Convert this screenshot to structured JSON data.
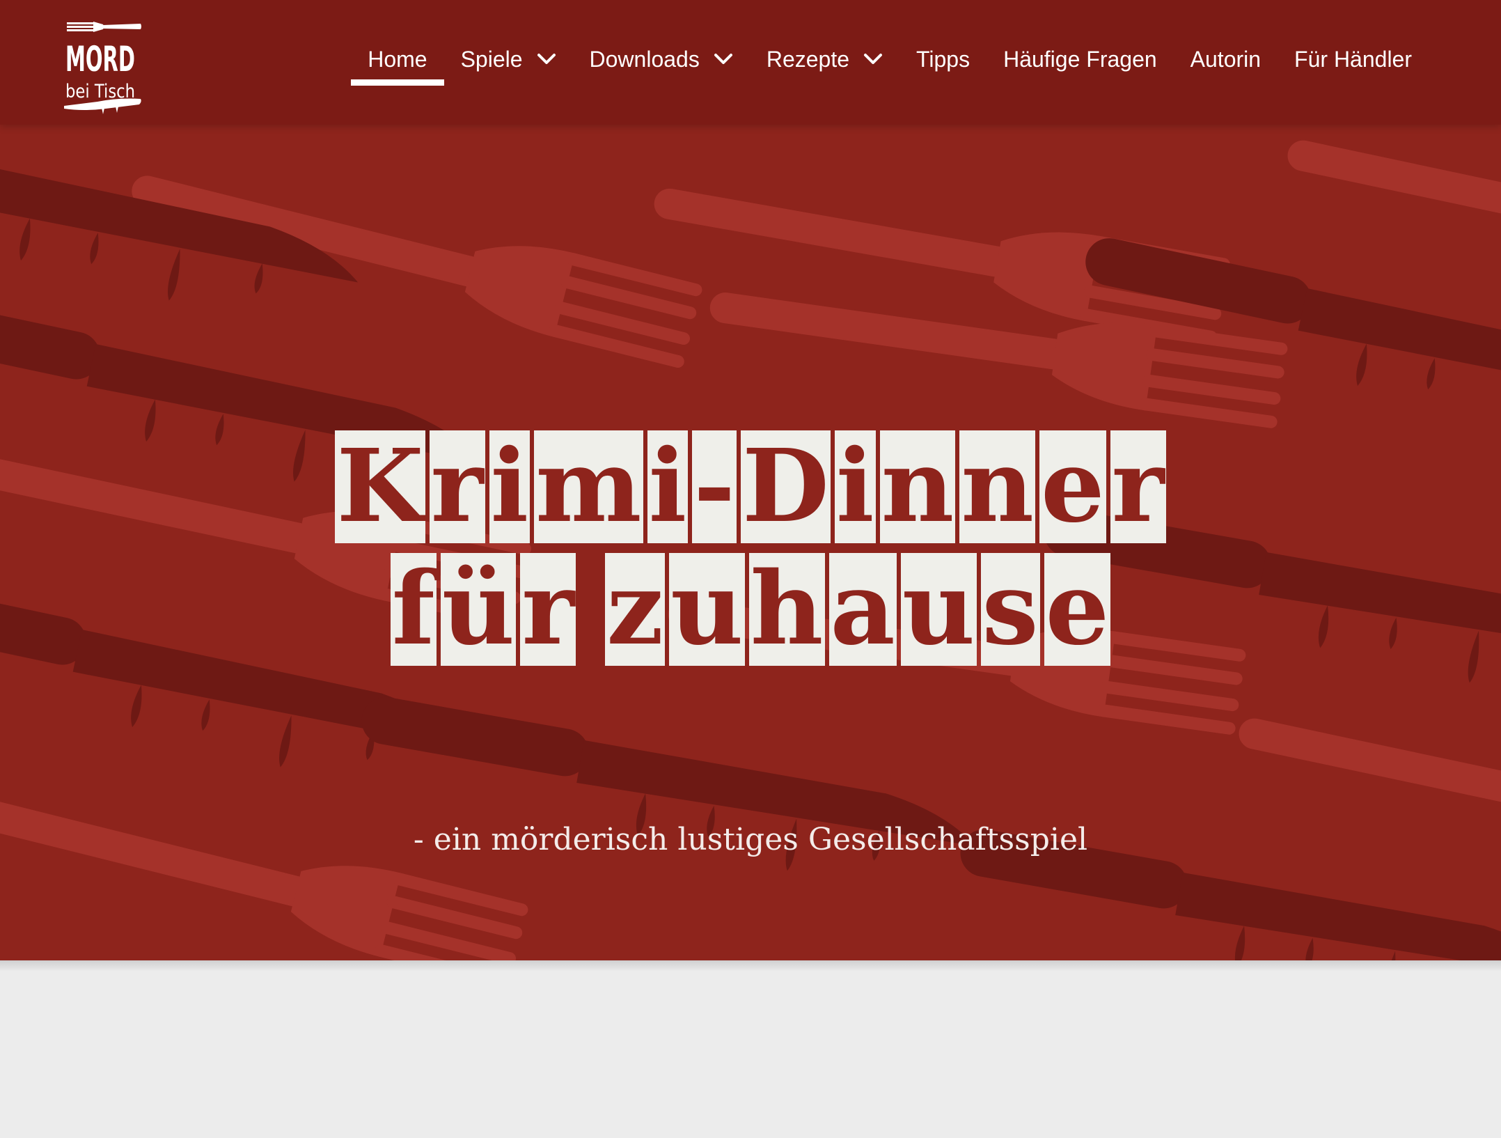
{
  "site": {
    "logo_text_top": "MORD",
    "logo_text_bottom": "bei Tisch"
  },
  "nav": {
    "items": [
      {
        "label": "Home",
        "active": true,
        "dropdown": false
      },
      {
        "label": "Spiele",
        "active": false,
        "dropdown": true
      },
      {
        "label": "Downloads",
        "active": false,
        "dropdown": true
      },
      {
        "label": "Rezepte",
        "active": false,
        "dropdown": true
      },
      {
        "label": "Tipps",
        "active": false,
        "dropdown": false
      },
      {
        "label": "Häufige Fragen",
        "active": false,
        "dropdown": false
      },
      {
        "label": "Autorin",
        "active": false,
        "dropdown": false
      },
      {
        "label": "Für Händler",
        "active": false,
        "dropdown": false
      }
    ],
    "dropdown_icon": "chevron-down-icon"
  },
  "hero": {
    "title_line1": "Krimi-Dinner",
    "title_line2": "für zuhause",
    "subtitle": "- ein mörderisch lustiges Gesellschaftsspiel",
    "background_motif": [
      "fork-icon",
      "bloody-knife-icon"
    ]
  },
  "colors": {
    "header": "#7c1b15",
    "hero_bg": "#8e241c",
    "motif_light": "#a5322a",
    "motif_dark": "#6e1914",
    "tile": "#efefea",
    "page_bg": "#ececec"
  }
}
